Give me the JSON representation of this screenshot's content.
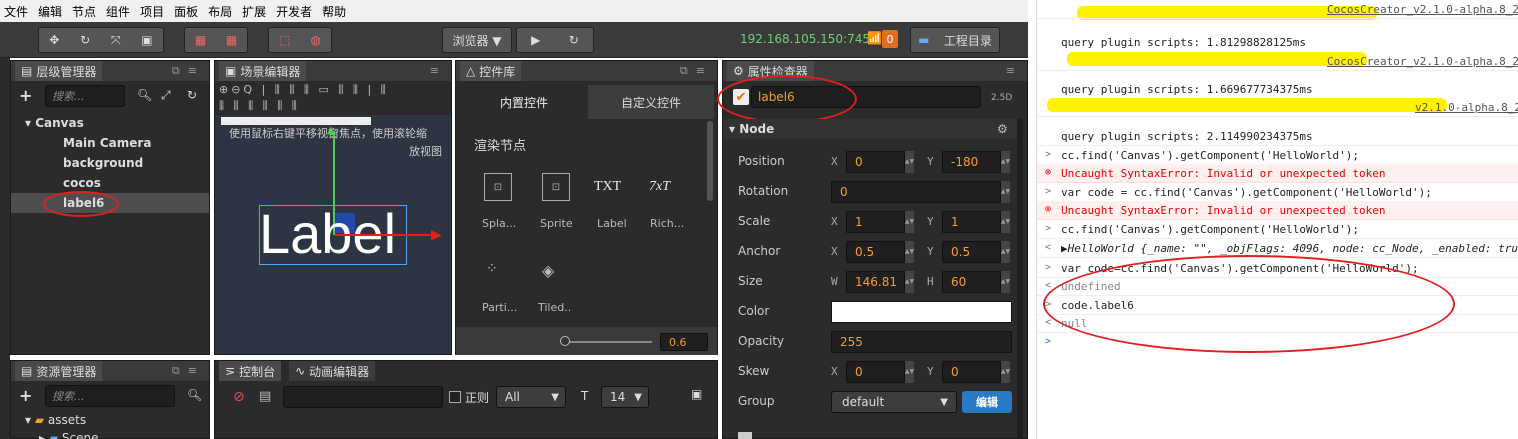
{
  "menu": [
    "文件",
    "编辑",
    "节点",
    "组件",
    "项目",
    "面板",
    "布局",
    "扩展",
    "开发者",
    "帮助"
  ],
  "toolbar": {
    "browser_label": "浏览器 ▼",
    "ip": "192.168.105.150:7456",
    "badge": "0",
    "project_label": "工程目录"
  },
  "hierarchy": {
    "title": "层级管理器",
    "search_placeholder": "搜索...",
    "nodes": [
      "Canvas",
      "Main Camera",
      "background",
      "cocos",
      "label6"
    ]
  },
  "scene": {
    "title": "场景编辑器",
    "hint": "使用鼠标右键平移视窗焦点，使用滚轮缩",
    "hint2": "放视图",
    "label_text": "Label"
  },
  "library": {
    "title": "控件库",
    "tab_builtin": "内置控件",
    "tab_custom": "自定义控件",
    "section": "渲染节点",
    "items": [
      "Spla...",
      "Sprite",
      "Label",
      "Rich...",
      "Parti...",
      "Tiled.."
    ],
    "txt1": "TXT",
    "txt2": "7xT",
    "zoom": "0.6"
  },
  "inspector": {
    "title": "属性检查器",
    "node_name": "label6",
    "mode": "2.5D",
    "section": "Node",
    "position": {
      "label": "Position",
      "x": "0",
      "y": "-180"
    },
    "rotation": {
      "label": "Rotation",
      "v": "0"
    },
    "scale": {
      "label": "Scale",
      "x": "1",
      "y": "1"
    },
    "anchor": {
      "label": "Anchor",
      "x": "0.5",
      "y": "0.5"
    },
    "size": {
      "label": "Size",
      "w": "146.81",
      "h": "60"
    },
    "color": {
      "label": "Color",
      "value": "#ffffff"
    },
    "opacity": {
      "label": "Opacity",
      "v": "255"
    },
    "skew": {
      "label": "Skew",
      "x": "0",
      "y": "0"
    },
    "group": {
      "label": "Group",
      "v": "default",
      "edit": "编辑"
    }
  },
  "assets": {
    "title": "资源管理器",
    "search_placeholder": "搜索...",
    "root": "assets",
    "child": "Scene"
  },
  "console_panel": {
    "title": "控制台",
    "anim_title": "动画编辑器",
    "regex": "正则",
    "level": "All",
    "fontsize": "14"
  },
  "devconsole": {
    "lines": [
      {
        "type": "link",
        "text": "CocosCreator_v2.1.0-alpha.8_2"
      },
      {
        "type": "log",
        "text": "query plugin scripts: 1.81298828125ms"
      },
      {
        "type": "link",
        "text": "CocosCreator_v2.1.0-alpha.8_2"
      },
      {
        "type": "log",
        "text": "query plugin scripts: 1.669677734375ms"
      },
      {
        "type": "link",
        "text": "v2.1.0-alpha.8_2"
      },
      {
        "type": "log",
        "text": "query plugin scripts: 2.114990234375ms"
      },
      {
        "type": "in",
        "text": "cc.find('Canvas').getComponent('HelloWorld');"
      },
      {
        "type": "err",
        "text": "Uncaught SyntaxError: Invalid or unexpected token"
      },
      {
        "type": "in",
        "text": "var code = cc.find('Canvas').getComponent('HelloWorld');"
      },
      {
        "type": "err",
        "text": "Uncaught SyntaxError: Invalid or unexpected token"
      },
      {
        "type": "in",
        "text": "cc.find('Canvas').getComponent('HelloWorld');"
      },
      {
        "type": "out",
        "text": "▶HelloWorld {_name: \"\", _objFlags: 4096, node: cc_Node, _enabled: tru"
      },
      {
        "type": "in",
        "text": "var code=cc.find('Canvas').getComponent('HelloWorld');"
      },
      {
        "type": "out",
        "text": "undefined"
      },
      {
        "type": "in",
        "text": "code.label6"
      },
      {
        "type": "out",
        "text": "null"
      },
      {
        "type": "prompt",
        "text": ""
      }
    ]
  }
}
